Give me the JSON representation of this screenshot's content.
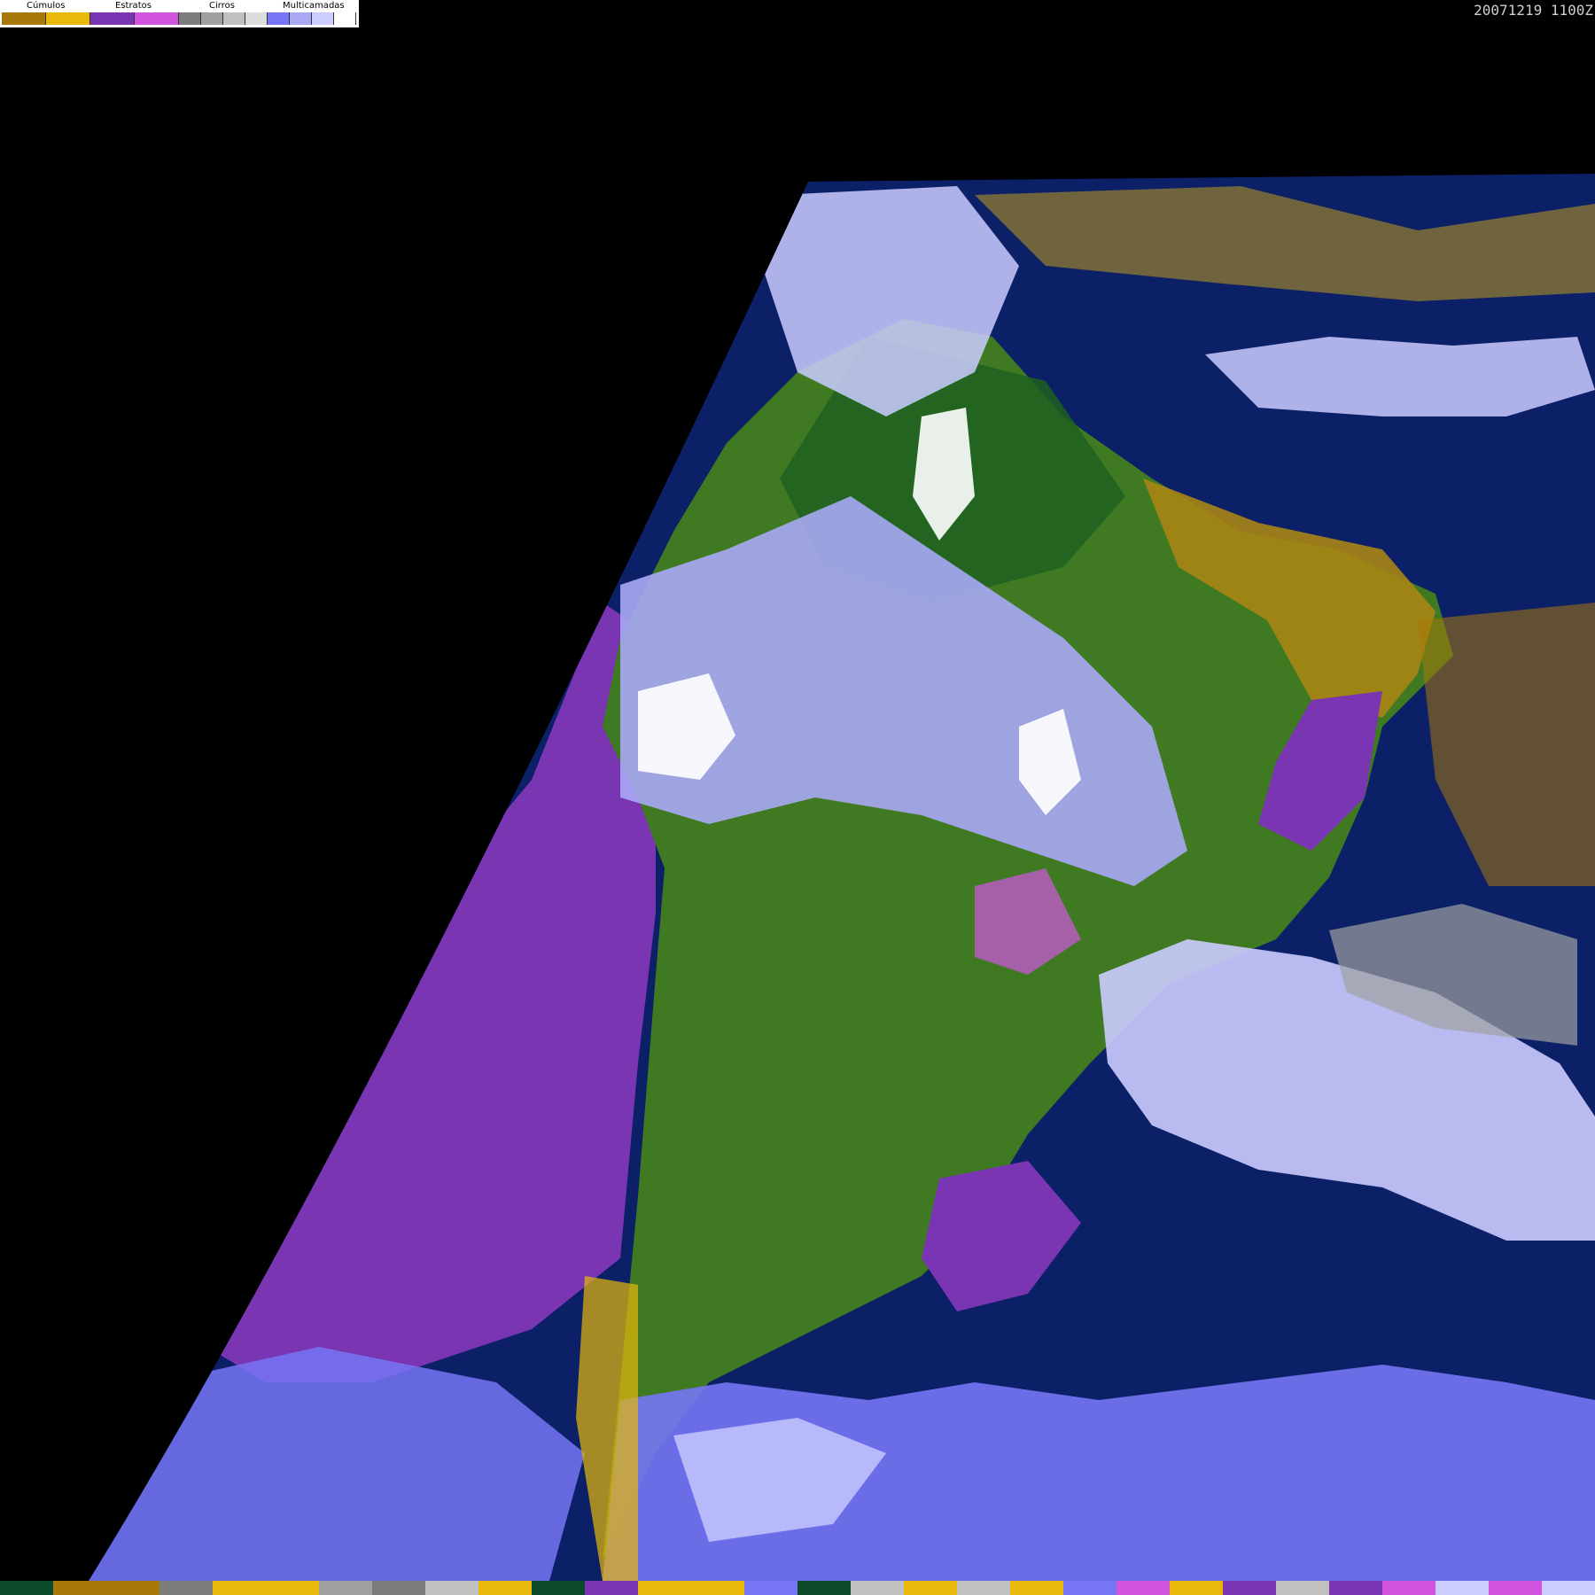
{
  "timestamp": "20071219 1100Z",
  "legend": {
    "groups": [
      {
        "label": "Cúmulos",
        "colors": [
          "#a8780a",
          "#e8b80a"
        ]
      },
      {
        "label": "Estratos",
        "colors": [
          "#7a35b3",
          "#d255e0"
        ]
      },
      {
        "label": "Cirros",
        "colors": [
          "#7c7c7c",
          "#a0a0a0",
          "#c0c0c0",
          "#dcdcdc"
        ]
      },
      {
        "label": "Multicamadas",
        "colors": [
          "#7575f5",
          "#a8a8f5",
          "#ccccff",
          "#ffffff"
        ]
      }
    ]
  },
  "map": {
    "colors": {
      "space": "#000000",
      "ocean": "#0c2068",
      "land": "#3f7a22",
      "land_dark": "#1e6020",
      "land_arid": "#a88414",
      "stratus": "#7a35b3",
      "stratus_light": "#d255e0",
      "cumulus": "#a8780a",
      "cumulus_light": "#e8b80a",
      "multilayer": "#7575f5",
      "multilayer_light": "#ccccff",
      "cloud_white": "#ffffff"
    }
  },
  "bottom_bar": [
    "#0a4a2a",
    "#a8780a",
    "#a8780a",
    "#7c7c7c",
    "#e8b80a",
    "#e8b80a",
    "#a0a0a0",
    "#7c7c7c",
    "#c0c0c0",
    "#e8b80a",
    "#0a4a2a",
    "#7a35b3",
    "#e8b80a",
    "#e8b80a",
    "#7575f5",
    "#0a4a2a",
    "#c0c0c0",
    "#e8b80a",
    "#c0c0c0",
    "#e8b80a",
    "#7575f5",
    "#d255e0",
    "#e8b80a",
    "#7a35b3",
    "#c0c0c0",
    "#7a35b3",
    "#d255e0",
    "#ccccff",
    "#d255e0",
    "#ccccff"
  ]
}
